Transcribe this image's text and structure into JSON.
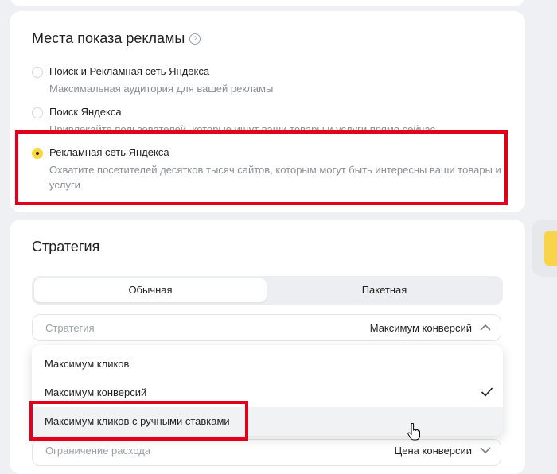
{
  "placements": {
    "title": "Места показа рекламы",
    "help_icon": "?",
    "options": [
      {
        "label": "Поиск и Рекламная сеть Яндекса",
        "description": "Максимальная аудитория для вашей рекламы",
        "selected": false
      },
      {
        "label": "Поиск Яндекса",
        "description": "Привлекайте пользователей, которые ищут ваши товары и услуги прямо сейчас",
        "selected": false
      },
      {
        "label": "Рекламная сеть Яндекса",
        "description": "Охватите посетителей десятков тысяч сайтов, которым могут быть интересны ваши товары и услуги",
        "selected": true
      }
    ]
  },
  "strategy": {
    "title": "Стратегия",
    "tabs": [
      "Обычная",
      "Пакетная"
    ],
    "active_tab": "Обычная",
    "select": {
      "label": "Стратегия",
      "value": "Максимум конверсий"
    },
    "dropdown": [
      {
        "label": "Максимум кликов",
        "checked": false
      },
      {
        "label": "Максимум конверсий",
        "checked": true
      },
      {
        "label": "Максимум кликов с ручными ставками",
        "checked": false
      }
    ],
    "limit": {
      "label": "Ограничение расхода",
      "value": "Цена конверсии"
    }
  },
  "colors": {
    "accent_yellow": "#fcd839",
    "highlight_red": "#e3001b"
  },
  "icons": {
    "help": "help-icon",
    "chevron_up": "chevron-up-icon",
    "chevron_down": "chevron-down-icon",
    "check": "check-icon",
    "cursor": "hand-cursor-icon"
  }
}
